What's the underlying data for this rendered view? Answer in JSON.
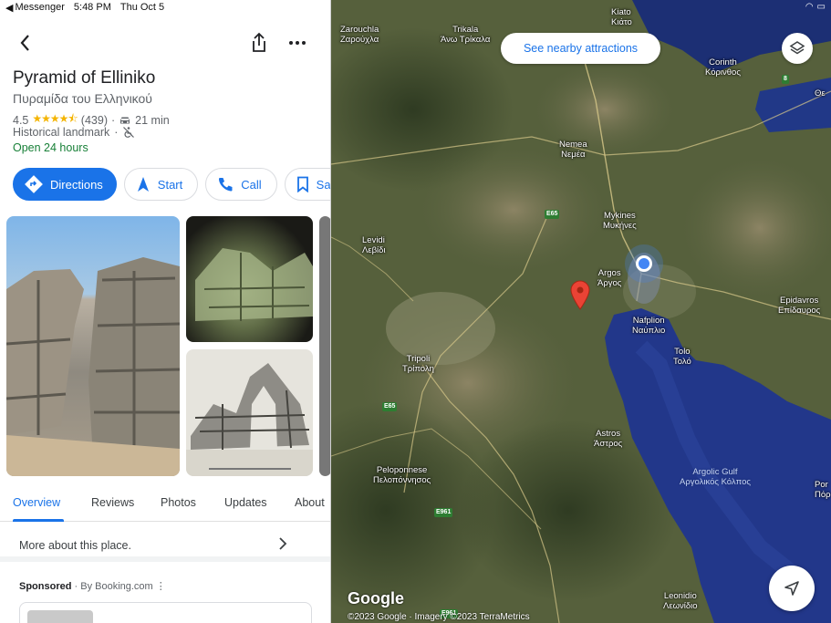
{
  "status_bar": {
    "back_app": "Messenger",
    "time": "5:48 PM",
    "date": "Thu Oct 5"
  },
  "place": {
    "name": "Pyramid of Elliniko",
    "name_local": "Πυραμίδα του Ελληνικού",
    "rating": "4.5",
    "reviews_count": "(439)",
    "drive_time": "21 min",
    "category": "Historical landmark",
    "hours": "Open 24 hours"
  },
  "actions": {
    "directions": "Directions",
    "start": "Start",
    "call": "Call",
    "save": "Sa"
  },
  "tabs": [
    "Overview",
    "Reviews",
    "Photos",
    "Updates",
    "About"
  ],
  "more_about": "More about this place.",
  "sponsored": {
    "label": "Sponsored",
    "by": "· By Booking.com"
  },
  "map": {
    "nearby_button": "See nearby attractions",
    "google": "Google",
    "attribution": "©2023 Google · Imagery ©2023 TerraMetrics",
    "places": [
      {
        "name": "Zarouchla",
        "local": "Ζαρούχλα"
      },
      {
        "name": "Trikala",
        "local": "Άνω Τρίκαλα"
      },
      {
        "name": "Kiato",
        "local": "Κιάτο"
      },
      {
        "name": "Corinth",
        "local": "Κόρινθος"
      },
      {
        "name": "Nemea",
        "local": "Νεμέα"
      },
      {
        "name": "Mykines",
        "local": "Μυκήνες"
      },
      {
        "name": "Levidi",
        "local": "Λεβίδι"
      },
      {
        "name": "Argos",
        "local": "Άργος"
      },
      {
        "name": "Epidavros",
        "local": "Επίδαυρος"
      },
      {
        "name": "Nafplion",
        "local": "Ναύπλιο"
      },
      {
        "name": "Tolo",
        "local": "Τολό"
      },
      {
        "name": "Tripoli",
        "local": "Τρίπολη"
      },
      {
        "name": "Astros",
        "local": "Άστρος"
      },
      {
        "name": "Peloponnese",
        "local": "Πελοπόννησος"
      },
      {
        "name": "Leonidio",
        "local": "Λεωνίδιο"
      },
      {
        "name": "Argolic Gulf",
        "local": "Αργολικός Κόλπος"
      },
      {
        "name": "Θε",
        "local": ""
      },
      {
        "name": "Por",
        "local": "Πόρ"
      }
    ],
    "road_shields": [
      "E65",
      "E65",
      "E961",
      "8",
      "E961"
    ]
  },
  "colors": {
    "accent": "#1a73e8",
    "open_green": "#188038",
    "star": "#f4b400",
    "pin": "#ea4335",
    "location": "#4285f4"
  }
}
